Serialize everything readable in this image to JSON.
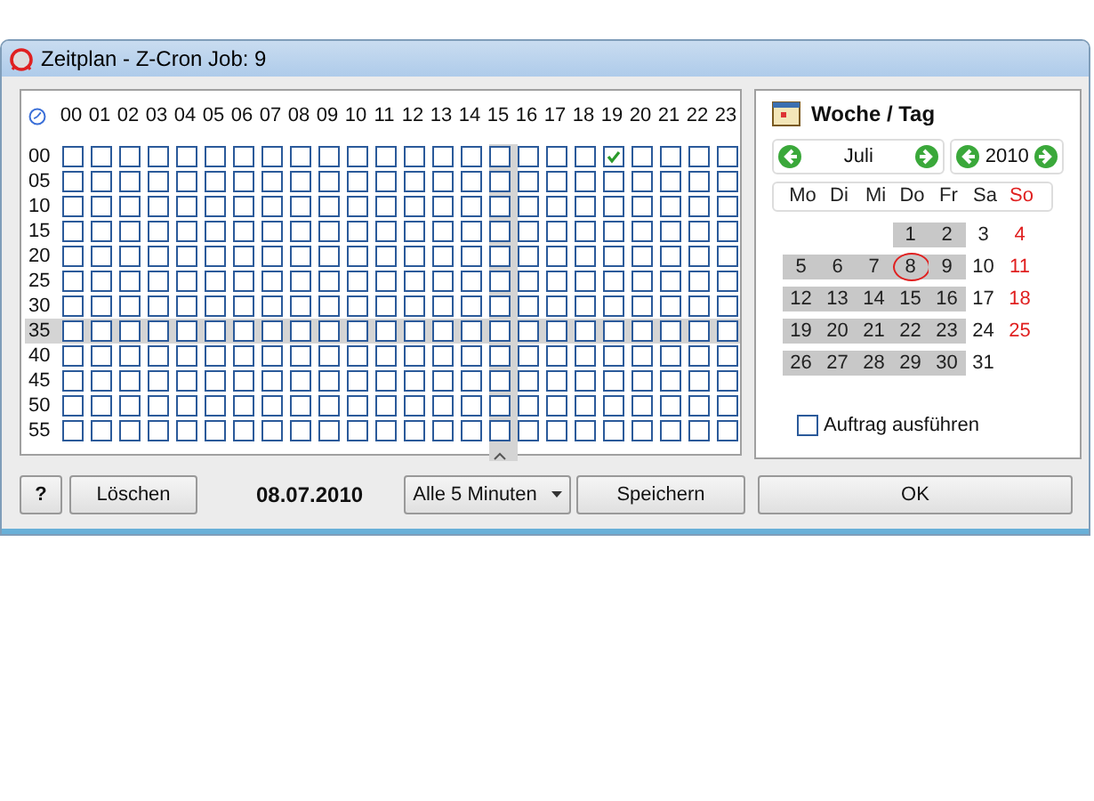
{
  "window": {
    "title": "Zeitplan - Z-Cron Job: 9"
  },
  "grid": {
    "columns": [
      {
        "label": "00",
        "highlighted": false
      },
      {
        "label": "01",
        "highlighted": false
      },
      {
        "label": "02",
        "highlighted": false
      },
      {
        "label": "03",
        "highlighted": false
      },
      {
        "label": "04",
        "highlighted": false
      },
      {
        "label": "05",
        "highlighted": false
      },
      {
        "label": "06",
        "highlighted": false
      },
      {
        "label": "07",
        "highlighted": false
      },
      {
        "label": "08",
        "highlighted": false
      },
      {
        "label": "09",
        "highlighted": false
      },
      {
        "label": "10",
        "highlighted": false
      },
      {
        "label": "11",
        "highlighted": false
      },
      {
        "label": "12",
        "highlighted": false
      },
      {
        "label": "13",
        "highlighted": false
      },
      {
        "label": "14",
        "highlighted": false
      },
      {
        "label": "15",
        "highlighted": true
      },
      {
        "label": "16",
        "highlighted": false
      },
      {
        "label": "17",
        "highlighted": false
      },
      {
        "label": "18",
        "highlighted": false
      },
      {
        "label": "19",
        "highlighted": false
      },
      {
        "label": "20",
        "highlighted": false
      },
      {
        "label": "21",
        "highlighted": false
      },
      {
        "label": "22",
        "highlighted": false
      },
      {
        "label": "23",
        "highlighted": false
      }
    ],
    "rows": [
      {
        "label": "00",
        "highlighted": false,
        "checked": [
          false,
          false,
          false,
          false,
          false,
          false,
          false,
          false,
          false,
          false,
          false,
          false,
          false,
          false,
          false,
          false,
          false,
          false,
          false,
          true,
          false,
          false,
          false,
          false
        ]
      },
      {
        "label": "05",
        "highlighted": false,
        "checked": [
          false,
          false,
          false,
          false,
          false,
          false,
          false,
          false,
          false,
          false,
          false,
          false,
          false,
          false,
          false,
          false,
          false,
          false,
          false,
          false,
          false,
          false,
          false,
          false
        ]
      },
      {
        "label": "10",
        "highlighted": false,
        "checked": [
          false,
          false,
          false,
          false,
          false,
          false,
          false,
          false,
          false,
          false,
          false,
          false,
          false,
          false,
          false,
          false,
          false,
          false,
          false,
          false,
          false,
          false,
          false,
          false
        ]
      },
      {
        "label": "15",
        "highlighted": false,
        "checked": [
          false,
          false,
          false,
          false,
          false,
          false,
          false,
          false,
          false,
          false,
          false,
          false,
          false,
          false,
          false,
          false,
          false,
          false,
          false,
          false,
          false,
          false,
          false,
          false
        ]
      },
      {
        "label": "20",
        "highlighted": false,
        "checked": [
          false,
          false,
          false,
          false,
          false,
          false,
          false,
          false,
          false,
          false,
          false,
          false,
          false,
          false,
          false,
          false,
          false,
          false,
          false,
          false,
          false,
          false,
          false,
          false
        ]
      },
      {
        "label": "25",
        "highlighted": false,
        "checked": [
          false,
          false,
          false,
          false,
          false,
          false,
          false,
          false,
          false,
          false,
          false,
          false,
          false,
          false,
          false,
          false,
          false,
          false,
          false,
          false,
          false,
          false,
          false,
          false
        ]
      },
      {
        "label": "30",
        "highlighted": false,
        "checked": [
          false,
          false,
          false,
          false,
          false,
          false,
          false,
          false,
          false,
          false,
          false,
          false,
          false,
          false,
          false,
          false,
          false,
          false,
          false,
          false,
          false,
          false,
          false,
          false
        ]
      },
      {
        "label": "35",
        "highlighted": true,
        "checked": [
          false,
          false,
          false,
          false,
          false,
          false,
          false,
          false,
          false,
          false,
          false,
          false,
          false,
          false,
          false,
          false,
          false,
          false,
          false,
          false,
          false,
          false,
          false,
          false
        ]
      },
      {
        "label": "40",
        "highlighted": false,
        "checked": [
          false,
          false,
          false,
          false,
          false,
          false,
          false,
          false,
          false,
          false,
          false,
          false,
          false,
          false,
          false,
          false,
          false,
          false,
          false,
          false,
          false,
          false,
          false,
          false
        ]
      },
      {
        "label": "45",
        "highlighted": false,
        "checked": [
          false,
          false,
          false,
          false,
          false,
          false,
          false,
          false,
          false,
          false,
          false,
          false,
          false,
          false,
          false,
          false,
          false,
          false,
          false,
          false,
          false,
          false,
          false,
          false
        ]
      },
      {
        "label": "50",
        "highlighted": false,
        "checked": [
          false,
          false,
          false,
          false,
          false,
          false,
          false,
          false,
          false,
          false,
          false,
          false,
          false,
          false,
          false,
          false,
          false,
          false,
          false,
          false,
          false,
          false,
          false,
          false
        ]
      },
      {
        "label": "55",
        "highlighted": false,
        "checked": [
          false,
          false,
          false,
          false,
          false,
          false,
          false,
          false,
          false,
          false,
          false,
          false,
          false,
          false,
          false,
          false,
          false,
          false,
          false,
          false,
          false,
          false,
          false,
          false
        ]
      }
    ]
  },
  "calendar": {
    "title": "Woche / Tag",
    "month": "Juli",
    "year": "2010",
    "weekdays": [
      {
        "label": "Mo",
        "color": "#222222"
      },
      {
        "label": "Di",
        "color": "#222222"
      },
      {
        "label": "Mi",
        "color": "#222222"
      },
      {
        "label": "Do",
        "color": "#222222"
      },
      {
        "label": "Fr",
        "color": "#222222"
      },
      {
        "label": "Sa",
        "color": "#222222"
      },
      {
        "label": "So",
        "color": "#e02020"
      }
    ],
    "weeks": [
      {
        "days": [
          {
            "label": "1",
            "selected": true,
            "today": false
          },
          {
            "label": "2",
            "selected": true,
            "today": false
          },
          {
            "label": "3",
            "selected": false,
            "today": false
          },
          {
            "label": "4",
            "selected": false,
            "today": false
          }
        ]
      },
      {
        "days": [
          {
            "label": "5",
            "selected": true,
            "today": false
          },
          {
            "label": "6",
            "selected": true,
            "today": false
          },
          {
            "label": "7",
            "selected": true,
            "today": false
          },
          {
            "label": "8",
            "selected": true,
            "today": true
          },
          {
            "label": "9",
            "selected": true,
            "today": false
          },
          {
            "label": "10",
            "selected": false,
            "today": false
          },
          {
            "label": "11",
            "selected": false,
            "today": false
          }
        ]
      },
      {
        "days": [
          {
            "label": "12",
            "selected": true,
            "today": false
          },
          {
            "label": "13",
            "selected": true,
            "today": false
          },
          {
            "label": "14",
            "selected": true,
            "today": false
          },
          {
            "label": "15",
            "selected": true,
            "today": false
          },
          {
            "label": "16",
            "selected": true,
            "today": false
          },
          {
            "label": "17",
            "selected": false,
            "today": false
          },
          {
            "label": "18",
            "selected": false,
            "today": false
          }
        ]
      },
      {
        "days": [
          {
            "label": "19",
            "selected": true,
            "today": false
          },
          {
            "label": "20",
            "selected": true,
            "today": false
          },
          {
            "label": "21",
            "selected": true,
            "today": false
          },
          {
            "label": "22",
            "selected": true,
            "today": false
          },
          {
            "label": "23",
            "selected": true,
            "today": false
          },
          {
            "label": "24",
            "selected": false,
            "today": false
          },
          {
            "label": "25",
            "selected": false,
            "today": false
          }
        ]
      },
      {
        "days": [
          {
            "label": "26",
            "selected": true,
            "today": false
          },
          {
            "label": "27",
            "selected": true,
            "today": false
          },
          {
            "label": "28",
            "selected": true,
            "today": false
          },
          {
            "label": "29",
            "selected": true,
            "today": false
          },
          {
            "label": "30",
            "selected": true,
            "today": false
          },
          {
            "label": "31",
            "selected": false,
            "today": false
          }
        ]
      }
    ],
    "run_job": {
      "label": "Auftrag ausführen",
      "checked": false
    }
  },
  "footer": {
    "help": "?",
    "clear": "Löschen",
    "date": "08.07.2010",
    "interval": "Alle 5 Minuten",
    "save": "Speichern",
    "ok": "OK"
  }
}
